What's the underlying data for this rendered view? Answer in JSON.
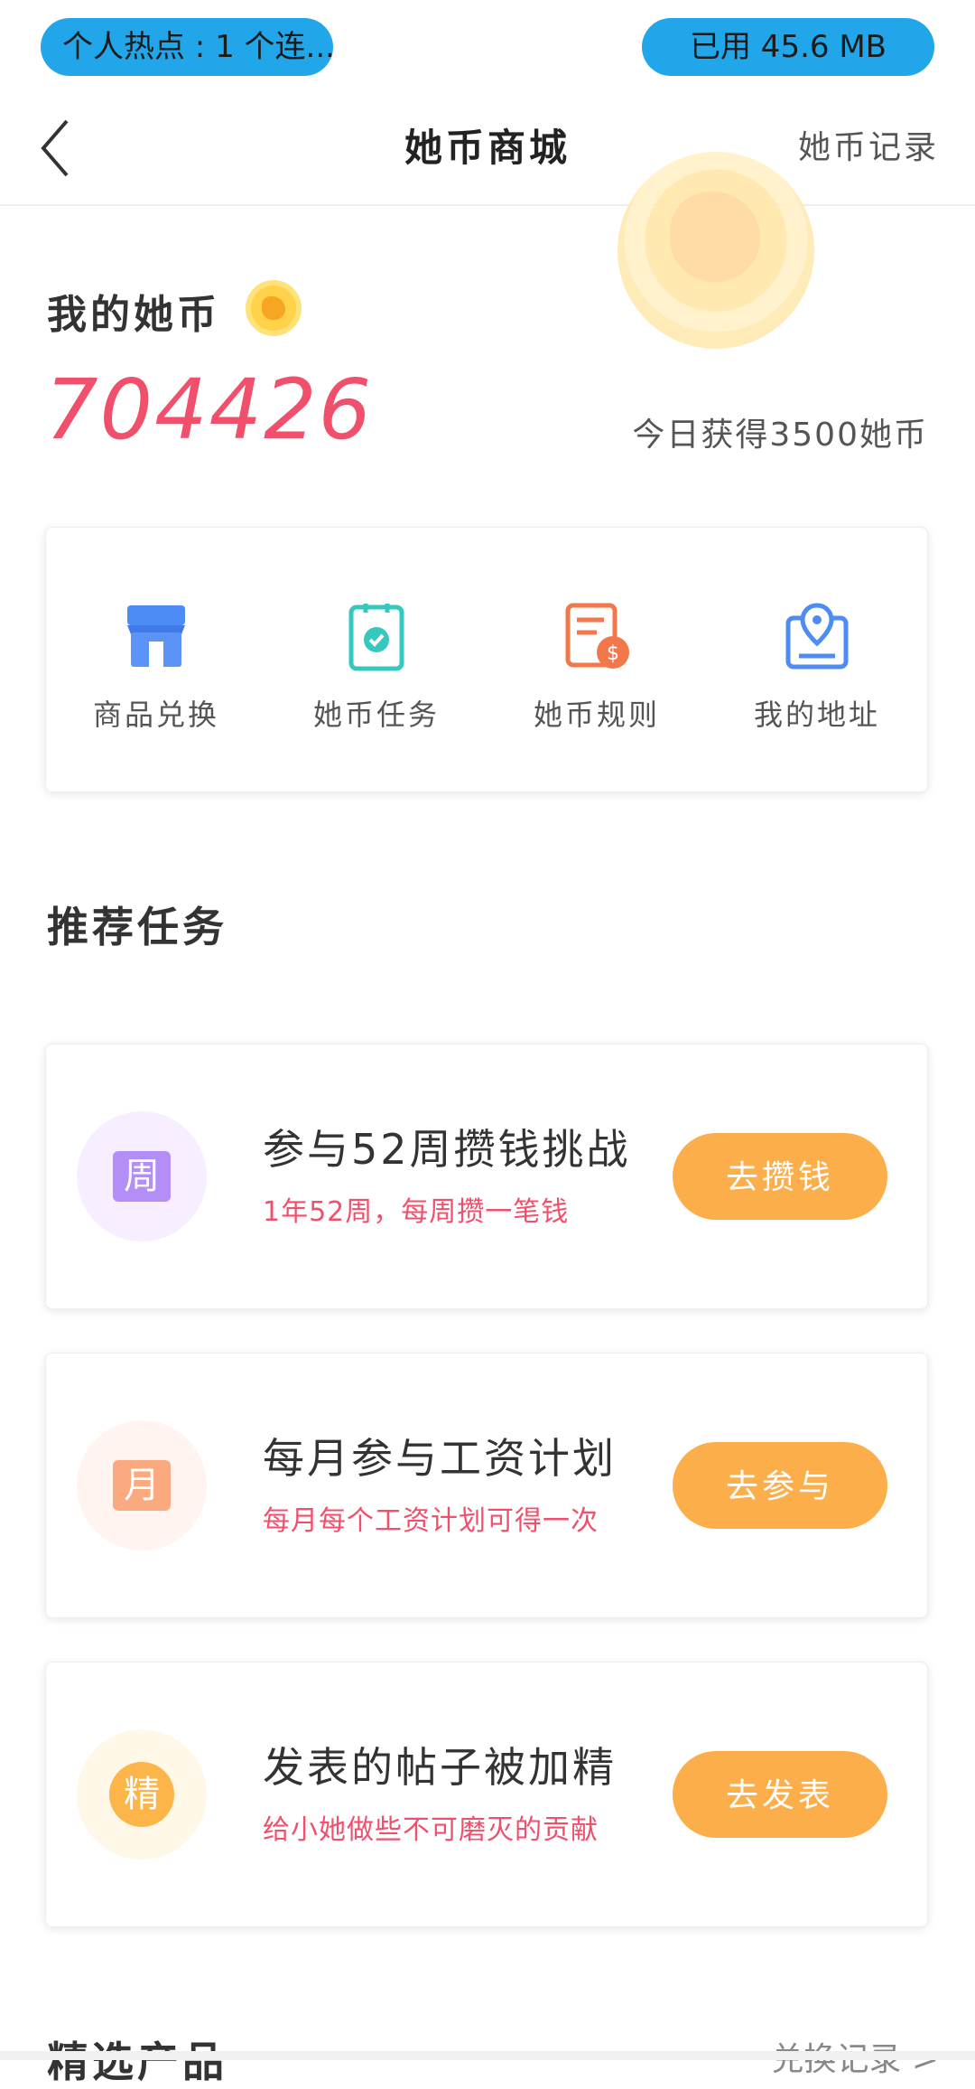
{
  "status_bar": {
    "hotspot_text": "个人热点 : 1 个连...",
    "data_used_text": "已用 45.6 MB",
    "pill_color": "#22a6ea"
  },
  "header": {
    "title": "她币商城",
    "record_link": "她币记录"
  },
  "coins": {
    "label": "我的她币",
    "balance": "704426",
    "today_earned": "今日获得3500她币",
    "balance_color": "#f1506c"
  },
  "menu": [
    {
      "label": "商品兑换",
      "icon": "store-icon"
    },
    {
      "label": "她币任务",
      "icon": "task-clipboard-icon"
    },
    {
      "label": "她币规则",
      "icon": "rules-document-icon"
    },
    {
      "label": "我的地址",
      "icon": "location-icon"
    }
  ],
  "recommended": {
    "title": "推荐任务",
    "tasks": [
      {
        "icon_text": "周",
        "title": "参与52周攒钱挑战",
        "subtitle": "1年52周，每周攒一笔钱",
        "button": "去攒钱"
      },
      {
        "icon_text": "月",
        "title": "每月参与工资计划",
        "subtitle": "每月每个工资计划可得一次",
        "button": "去参与"
      },
      {
        "icon_text": "精",
        "title": "发表的帖子被加精",
        "subtitle": "给小她做些不可磨灭的贡献",
        "button": "去发表"
      }
    ]
  },
  "products": {
    "title": "精选产品",
    "link": "兑换记录 >"
  },
  "accent_color": "#fcae4a"
}
